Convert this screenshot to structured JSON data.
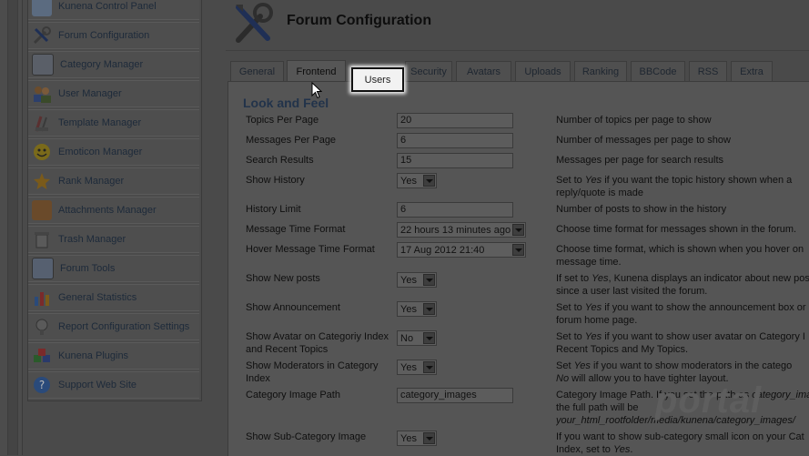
{
  "sidebar": {
    "items": [
      {
        "label": "Kunena Control Panel",
        "icon": "control-panel-icon"
      },
      {
        "label": "Forum Configuration",
        "icon": "tools-icon"
      },
      {
        "label": "Category Manager",
        "icon": "category-icon"
      },
      {
        "label": "User Manager",
        "icon": "users-icon"
      },
      {
        "label": "Template Manager",
        "icon": "template-icon"
      },
      {
        "label": "Emoticon Manager",
        "icon": "emoticon-icon"
      },
      {
        "label": "Rank Manager",
        "icon": "rank-icon"
      },
      {
        "label": "Attachments Manager",
        "icon": "attachments-icon"
      },
      {
        "label": "Trash Manager",
        "icon": "trash-icon"
      },
      {
        "label": "Forum Tools",
        "icon": "forum-tools-icon"
      },
      {
        "label": "General Statistics",
        "icon": "statistics-icon"
      },
      {
        "label": "Report Configuration Settings",
        "icon": "report-icon"
      },
      {
        "label": "Kunena Plugins",
        "icon": "plugins-icon"
      },
      {
        "label": "Support Web Site",
        "icon": "help-icon"
      }
    ]
  },
  "header": {
    "title": "Forum Configuration"
  },
  "tabs": [
    "General",
    "Frontend",
    "Users",
    "Security",
    "Avatars",
    "Uploads",
    "Ranking",
    "BBCode",
    "RSS",
    "Extra"
  ],
  "section": {
    "title": "Look and Feel"
  },
  "rows": [
    {
      "label": "Topics Per Page",
      "value": "20",
      "desc1": "Number of topics per page to show"
    },
    {
      "label": "Messages Per Page",
      "value": "6",
      "desc1": "Number of messages per page to show"
    },
    {
      "label": "Search Results",
      "value": "15",
      "desc1": "Messages per page for search results"
    },
    {
      "label": "Show History",
      "value": "Yes",
      "desc1a": "Set to ",
      "desc1i": "Yes",
      "desc1b": " if you want the topic history shown when a",
      "desc2": "reply/quote is made"
    },
    {
      "label": "History Limit",
      "value": "6",
      "desc1": "Number of posts to show in the history"
    },
    {
      "label": "Message Time Format",
      "value": "22 hours 13 minutes ago",
      "desc1": "Choose time format for messages shown in the forum."
    },
    {
      "label": "Hover Message Time Format",
      "value": "17 Aug 2012 21:40",
      "desc1": "Choose time format, which is shown when you hover on",
      "desc2": "message time."
    },
    {
      "label": "Show New posts",
      "value": "Yes",
      "desc1a": "If set to ",
      "desc1i": "Yes",
      "desc1b": ", Kunena displays an indicator about new post",
      "desc2": "since a user last visited the forum."
    },
    {
      "label": "Show Announcement",
      "value": "Yes",
      "desc1a": "Set to ",
      "desc1i": "Yes",
      "desc1b": " if you want to show the announcement box or",
      "desc2": "forum home page."
    },
    {
      "label1": "Show Avatar on Categoriy Index",
      "label2": "and Recent Topics",
      "value": "No",
      "desc1a": "Set to ",
      "desc1i": "Yes",
      "desc1b": " if you want to show user avatar on Category I",
      "desc2": "Recent Topics and My Topics."
    },
    {
      "label1": "Show Moderators in Category",
      "label2": "Index",
      "value": "Yes",
      "desc1a": "Set ",
      "desc1i": "Yes",
      "desc1b": " if you want to show moderators in the catego",
      "desc2i": "No",
      "desc2b": " will allow you to have tighter layout."
    },
    {
      "label": "Category Image Path",
      "value": "category_images",
      "desc1a": "Category Image Path. If you set the path as ",
      "desc1i": "category_ima",
      "desc2": "the full path will be",
      "desc3i": "your_html_rootfolder/media/kunena/category_images/"
    },
    {
      "label": "Show Sub-Category Image",
      "value": "Yes",
      "desc1a": "If you want to show sub-category small icon on your Cat",
      "desc2a": "Index, set to ",
      "desc2i": "Yes",
      "desc2b": "."
    }
  ],
  "watermark": "portal"
}
